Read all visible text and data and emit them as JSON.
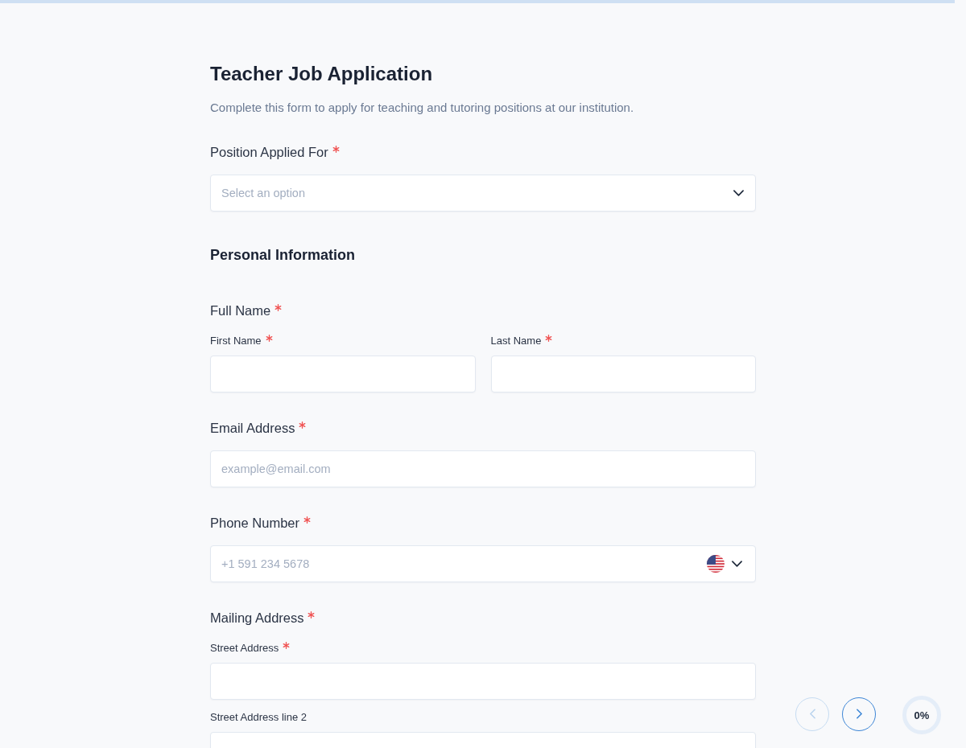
{
  "header": {
    "title": "Teacher Job Application",
    "description": "Complete this form to apply for teaching and tutoring positions at our institution."
  },
  "fields": [
    {
      "kind": "select",
      "label": "Position Applied For",
      "required": true,
      "placeholder": "Select an option"
    },
    {
      "kind": "heading",
      "text": "Personal Information"
    },
    {
      "kind": "split_group",
      "label": "Full Name",
      "required": true,
      "fields": [
        {
          "label": "First Name",
          "required": true
        },
        {
          "label": "Last Name",
          "required": true
        }
      ]
    },
    {
      "kind": "input",
      "label": "Email Address",
      "required": true,
      "placeholder": "example@email.com"
    },
    {
      "kind": "phone",
      "label": "Phone Number",
      "required": true,
      "placeholder": "+1 591 234 5678"
    },
    {
      "kind": "stacked_group",
      "label": "Mailing Address",
      "required": true,
      "fields": [
        {
          "label": "Street Address",
          "required": true
        },
        {
          "label": "Street Address line 2",
          "required": false
        }
      ]
    }
  ],
  "navigation": {
    "previous": {
      "disabled": true
    },
    "next": {
      "disabled": false
    }
  },
  "progress": {
    "reading": "0%"
  }
}
